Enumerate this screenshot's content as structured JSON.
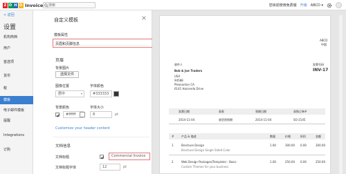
{
  "topbar": {
    "brand_letters": [
      "Z",
      "O",
      "H",
      "O"
    ],
    "brand_colors": [
      "#e42527",
      "#089949",
      "#226db4",
      "#f9b21d"
    ],
    "app_name": "Invoice",
    "search_placeholder": "搜索",
    "signup_text": "您目前使用免费版",
    "upgrade_text": "升级",
    "org_name": "ABCD ▾"
  },
  "leftnav": {
    "back": "< 返回",
    "title": "设置",
    "items": [
      {
        "label": "机构简档"
      },
      {
        "label": "用户"
      },
      {
        "label": "首选项"
      },
      {
        "label": "货币"
      },
      {
        "label": "税"
      },
      {
        "label": "模板"
      },
      {
        "label": "电子邮件模板"
      },
      {
        "label": "提醒"
      },
      {
        "label": "Integrations"
      },
      {
        "label": "订购"
      }
    ],
    "active_label": "模板"
  },
  "panel": {
    "title": "自定义模板",
    "section_template_props": "模板属性",
    "section_header_footer": "页眉和页脚信息",
    "page_header": "页眉",
    "bg_image_label": "背景图片",
    "choose_file": "选择文件",
    "image_position_label": "图像位置",
    "image_position_value": "居中",
    "font_color_label": "字体颜色",
    "font_color_value": "#333333",
    "bg_color_label": "背景颜色",
    "bg_color_value": "#ffffff",
    "font_size_label": "字体大小",
    "font_size_value": "8",
    "font_size_unit": "pt",
    "customize_link": "Customize your header content",
    "doc_info_header": "文档信息",
    "doc_title_label": "文档标题",
    "doc_title_value": "Commercial Invoice",
    "doc_title_font_label": "文档标题字体",
    "doc_title_font_value": "12",
    "doc_title_font_unit": "pt"
  },
  "preview": {
    "company": "ABCD",
    "country": "中国",
    "bill_to_label": "收件人",
    "bill_to_name": "Bob & Joe Traders",
    "addr1": "USA",
    "addr2": "94588",
    "addr3": "Pleasanton CA",
    "addr4": "6141 Hacienda Drive",
    "doc_label": "发票号码",
    "doc_number": "INV-17",
    "table1_headers": [
      "发票日期",
      "条款",
      "到期日期",
      "采购订单#"
    ],
    "table1_values": [
      "2014-11-04",
      "收货则到期",
      "2014-11-04",
      "SO-2145"
    ],
    "table2_headers": [
      "#",
      "产品 & 描述",
      "数量",
      "价格",
      "折扣",
      "金额"
    ],
    "row1_num": "1",
    "row1_title": "Brochure Design",
    "row1_desc": "Brochure Design Single Sided Color",
    "row1_qty": "1.00",
    "row1_price": "300.00",
    "row1_disc": "0.00",
    "row1_amt": "300.00",
    "row2_num": "2",
    "row2_title": "Web Design Packages(Template) - Basic",
    "row2_desc": "Custom Themes for your business",
    "row2_qty": "1.00",
    "row2_price": "250.00",
    "row2_disc": "0.00",
    "row2_amt": "250.00"
  }
}
